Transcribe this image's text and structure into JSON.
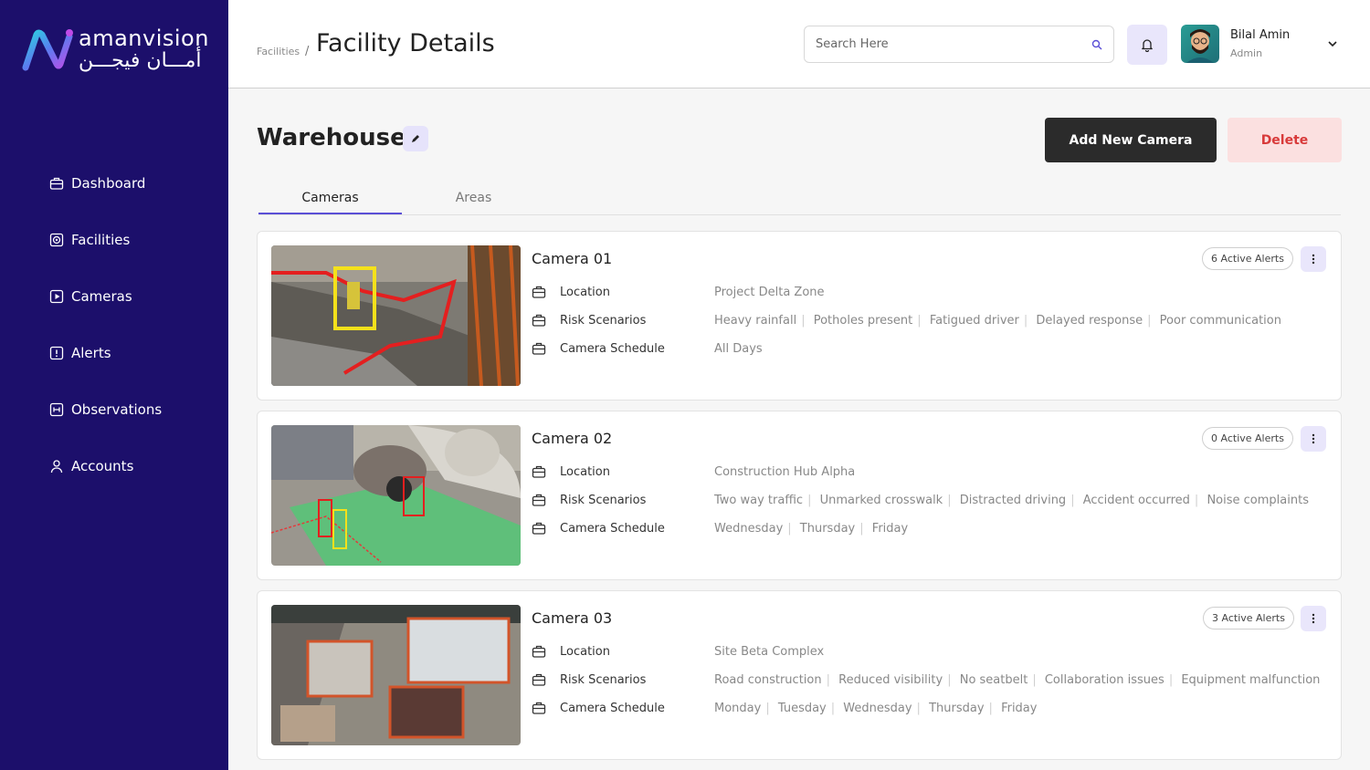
{
  "brand": {
    "name_en": "amanvision",
    "name_ar": "أمـــان فيجـــن",
    "accent": "#5b4fd6",
    "sidebar_bg": "#1c0f6b"
  },
  "sidebar": {
    "items": [
      {
        "label": "Dashboard",
        "icon": "briefcase-icon"
      },
      {
        "label": "Facilities",
        "icon": "target-icon"
      },
      {
        "label": "Cameras",
        "icon": "play-square-icon"
      },
      {
        "label": "Alerts",
        "icon": "alert-square-icon"
      },
      {
        "label": "Observations",
        "icon": "observation-icon"
      },
      {
        "label": "Accounts",
        "icon": "user-icon"
      }
    ]
  },
  "header": {
    "breadcrumb": "Facilities",
    "separator": "/",
    "title": "Facility Details",
    "search_placeholder": "Search Here",
    "user_name": "Bilal Amin",
    "user_role": "Admin"
  },
  "facility": {
    "name": "Warehouse",
    "add_camera_label": "Add New Camera",
    "delete_label": "Delete"
  },
  "tabs": [
    {
      "label": "Cameras"
    },
    {
      "label": "Areas"
    }
  ],
  "labels": {
    "location": "Location",
    "risk": "Risk Scenarios",
    "schedule": "Camera Schedule"
  },
  "cameras": [
    {
      "title": "Camera 01",
      "alerts": "6 Active Alerts",
      "location": "Project Delta Zone",
      "risks": [
        "Heavy rainfall",
        "Potholes present",
        "Fatigued driver",
        "Delayed response",
        "Poor communication"
      ],
      "schedule": [
        "All Days"
      ]
    },
    {
      "title": "Camera 02",
      "alerts": "0 Active Alerts",
      "location": "Construction Hub Alpha",
      "risks": [
        "Two way traffic",
        "Unmarked crosswalk",
        "Distracted driving",
        "Accident occurred",
        "Noise complaints"
      ],
      "schedule": [
        "Wednesday",
        "Thursday",
        "Friday"
      ]
    },
    {
      "title": "Camera 03",
      "alerts": "3 Active Alerts",
      "location": "Site Beta Complex",
      "risks": [
        "Road construction",
        "Reduced visibility",
        "No seatbelt",
        "Collaboration issues",
        "Equipment malfunction"
      ],
      "schedule": [
        "Monday",
        "Tuesday",
        "Wednesday",
        "Thursday",
        "Friday"
      ]
    }
  ]
}
